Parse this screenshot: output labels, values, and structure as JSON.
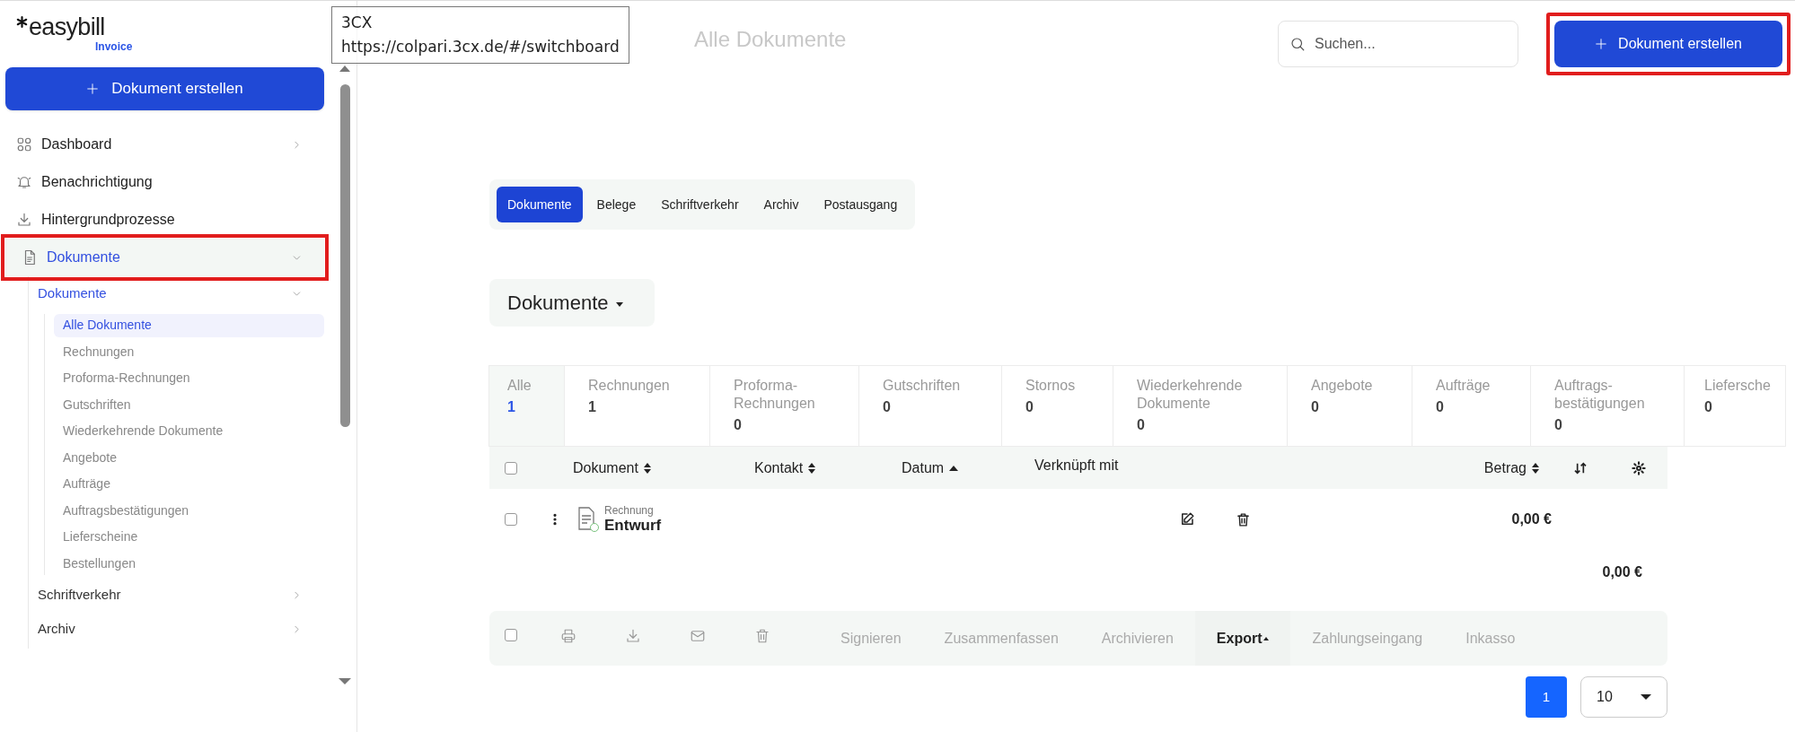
{
  "app": {
    "logo": "easybill",
    "product": "Invoice"
  },
  "sidebar": {
    "create_button": {
      "label": "Dokument erstellen"
    },
    "items": [
      {
        "label": "Dashboard",
        "expanded": false,
        "selected": false,
        "highlighted": false
      },
      {
        "label": "Benachrichtigung",
        "selected": false,
        "highlighted": false
      },
      {
        "label": "Hintergrundprozesse",
        "selected": false,
        "highlighted": false
      },
      {
        "label": "Dokumente",
        "expanded": true,
        "selected": true,
        "highlighted": true,
        "children": [
          {
            "label": "Dokumente",
            "expanded": true,
            "selected": true,
            "children": [
              {
                "label": "Alle Dokumente",
                "selected": true
              },
              {
                "label": "Rechnungen",
                "selected": false
              },
              {
                "label": "Proforma-Rechnungen",
                "selected": false
              },
              {
                "label": "Gutschriften",
                "selected": false
              },
              {
                "label": "Wiederkehrende Dokumente",
                "selected": false
              },
              {
                "label": "Angebote",
                "selected": false
              },
              {
                "label": "Aufträge",
                "selected": false
              },
              {
                "label": "Auftragsbestätigungen",
                "selected": false
              },
              {
                "label": "Lieferscheine",
                "selected": false
              },
              {
                "label": "Bestellungen",
                "selected": false
              }
            ]
          },
          {
            "label": "Schriftverkehr",
            "expanded": false,
            "selected": false
          },
          {
            "label": "Archiv",
            "expanded": false,
            "selected": false
          }
        ]
      }
    ]
  },
  "tooltip": {
    "lines": [
      "3CX",
      "https://colpari.3cx.de/#/switchboard"
    ]
  },
  "header": {
    "title": "Alle Dokumente",
    "search": {
      "placeholder": "Suchen..."
    },
    "create_button": {
      "label": "Dokument erstellen",
      "highlighted": true
    }
  },
  "section_tabs": [
    {
      "label": "Dokumente",
      "selected": true
    },
    {
      "label": "Belege",
      "selected": false
    },
    {
      "label": "Schriftverkehr",
      "selected": false
    },
    {
      "label": "Archiv",
      "selected": false
    },
    {
      "label": "Postausgang",
      "selected": false
    }
  ],
  "view_selector": {
    "label": "Dokumente"
  },
  "category_tabs": [
    {
      "label": "Alle",
      "count": "1",
      "selected": true
    },
    {
      "label": "Rechnungen",
      "count": "1",
      "selected": false
    },
    {
      "label": "Proforma-Rechnungen",
      "count": "0",
      "selected": false
    },
    {
      "label": "Gutschriften",
      "count": "0",
      "selected": false
    },
    {
      "label": "Stornos",
      "count": "0",
      "selected": false
    },
    {
      "label": "Wiederkehrende Dokumente",
      "count": "0",
      "selected": false
    },
    {
      "label": "Angebote",
      "count": "0",
      "selected": false
    },
    {
      "label": "Aufträge",
      "count": "0",
      "selected": false
    },
    {
      "label": "Auftrags-bestätigungen",
      "count": "0",
      "selected": false
    },
    {
      "label": "Liefersche",
      "count": "0",
      "selected": false
    }
  ],
  "table": {
    "select_all": {
      "checked": false
    },
    "columns": [
      {
        "label": "Dokument",
        "sortable": true,
        "sorted": false
      },
      {
        "label": "Kontakt",
        "sortable": true,
        "sorted": false
      },
      {
        "label": "Datum",
        "sortable": true,
        "sorted": true
      },
      {
        "label": "Verknüpft mit",
        "sortable": false
      },
      {
        "label": "Betrag",
        "sortable": true,
        "sorted": false
      }
    ],
    "rows": [
      {
        "checked": false,
        "type": "Rechnung",
        "status": "Entwurf",
        "amount": "0,00 €"
      }
    ],
    "total": "0,00 €"
  },
  "bulk_actions": {
    "select_all": {
      "checked": false
    },
    "actions": [
      {
        "label": "Signieren",
        "disabled": true,
        "dropdown": false
      },
      {
        "label": "Zusammenfassen",
        "disabled": true,
        "dropdown": false
      },
      {
        "label": "Archivieren",
        "disabled": true,
        "dropdown": false
      },
      {
        "label": "Export",
        "disabled": false,
        "dropdown": true
      },
      {
        "label": "Zahlungseingang",
        "disabled": true,
        "dropdown": false
      },
      {
        "label": "Inkasso",
        "disabled": true,
        "dropdown": false
      }
    ]
  },
  "pagination": {
    "pages": [
      {
        "label": "1",
        "selected": true
      }
    ],
    "per_page": "10"
  }
}
